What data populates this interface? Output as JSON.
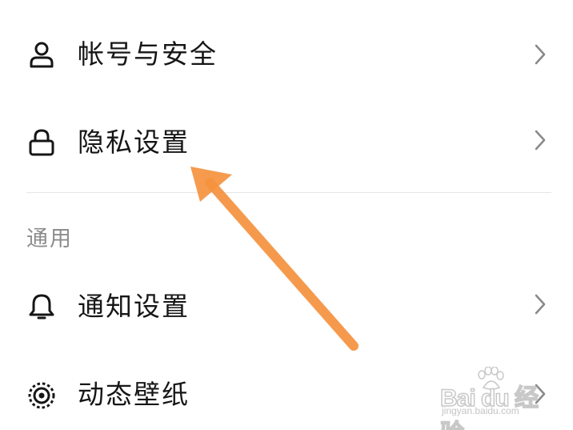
{
  "settings": {
    "items_top": [
      {
        "label": "帐号与安全",
        "icon": "person-icon"
      },
      {
        "label": "隐私设置",
        "icon": "lock-icon"
      }
    ],
    "section_general": {
      "title": "通用",
      "items": [
        {
          "label": "通知设置",
          "icon": "bell-icon"
        },
        {
          "label": "动态壁纸",
          "icon": "live-wallpaper-icon"
        }
      ]
    }
  },
  "annotation": {
    "arrow_color": "#f5923e",
    "points_to": "隐私设置"
  },
  "watermark": {
    "logo": "Bai du 经验",
    "url": "jingyan.baidu.com"
  },
  "colors": {
    "text": "#161616",
    "section_title": "#8c8c8c",
    "chevron": "#8a8a8a",
    "divider": "#e6e6e6"
  }
}
